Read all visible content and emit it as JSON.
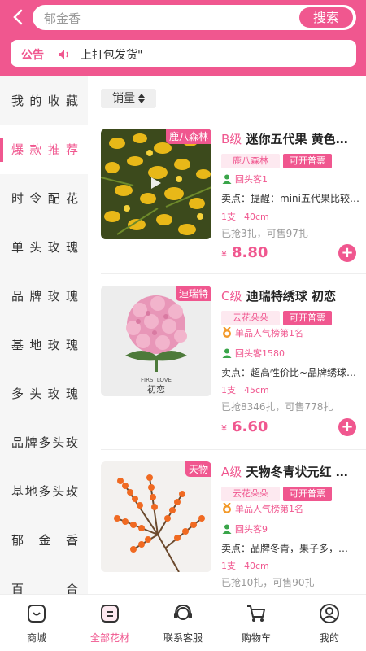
{
  "header": {
    "search_placeholder": "郁金香",
    "search_button": "搜索",
    "notice_tag": "公告",
    "notice_text": "上打包发货\""
  },
  "sidebar": {
    "items": [
      {
        "label": "我的收藏"
      },
      {
        "label": "爆款推荐",
        "active": true
      },
      {
        "label": "时令配花"
      },
      {
        "label": "单头玫瑰"
      },
      {
        "label": "品牌玫瑰"
      },
      {
        "label": "基地玫瑰"
      },
      {
        "label": "多头玫瑰"
      },
      {
        "label": "品牌多头玫"
      },
      {
        "label": "基地多头玫"
      },
      {
        "label": "郁金香"
      },
      {
        "label": "百合"
      }
    ]
  },
  "sort": {
    "label": "销量"
  },
  "products": [
    {
      "source_tag": "鹿八森林",
      "grade": "B级",
      "name": "迷你五代果 黄色…",
      "shop": "鹿八森林",
      "invoice": "可开普票",
      "rank": "",
      "repeat": "回头客1",
      "selling": "卖点：提醒：mini五代果比较…",
      "qty": "1支",
      "length": "40cm",
      "sold": "已抢3扎，可售97扎",
      "currency": "¥",
      "price": "8.80"
    },
    {
      "source_tag": "迪瑞特",
      "grade": "C级",
      "name": "迪瑞特绣球 初恋",
      "shop": "云花朵朵",
      "invoice": "可开普票",
      "rank": "单品人气榜第1名",
      "repeat": "回头客1580",
      "selling": "卖点：超高性价比~品牌绣球…",
      "qty": "1支",
      "length": "45cm",
      "sold": "已抢8346扎，可售778扎",
      "currency": "¥",
      "price": "6.60",
      "image_caption_en": "FIRSTLOVE",
      "image_caption_cn": "初恋"
    },
    {
      "source_tag": "天物",
      "grade": "A级",
      "name": "天物冬青状元红 …",
      "shop": "云花朵朵",
      "invoice": "可开普票",
      "rank": "单品人气榜第1名",
      "repeat": "回头客9",
      "selling": "卖点：品牌冬青，果子多，…",
      "qty": "1支",
      "length": "40cm",
      "sold": "已抢10扎，可售90扎"
    }
  ],
  "tabbar": {
    "items": [
      {
        "label": "商城",
        "icon": "shop-icon"
      },
      {
        "label": "全部花材",
        "icon": "category-icon",
        "active": true
      },
      {
        "label": "联系客服",
        "icon": "headset-icon"
      },
      {
        "label": "购物车",
        "icon": "cart-icon"
      },
      {
        "label": "我的",
        "icon": "user-icon"
      }
    ]
  },
  "colors": {
    "accent": "#f0578f",
    "sidebar_bg": "#f6f6f6"
  }
}
